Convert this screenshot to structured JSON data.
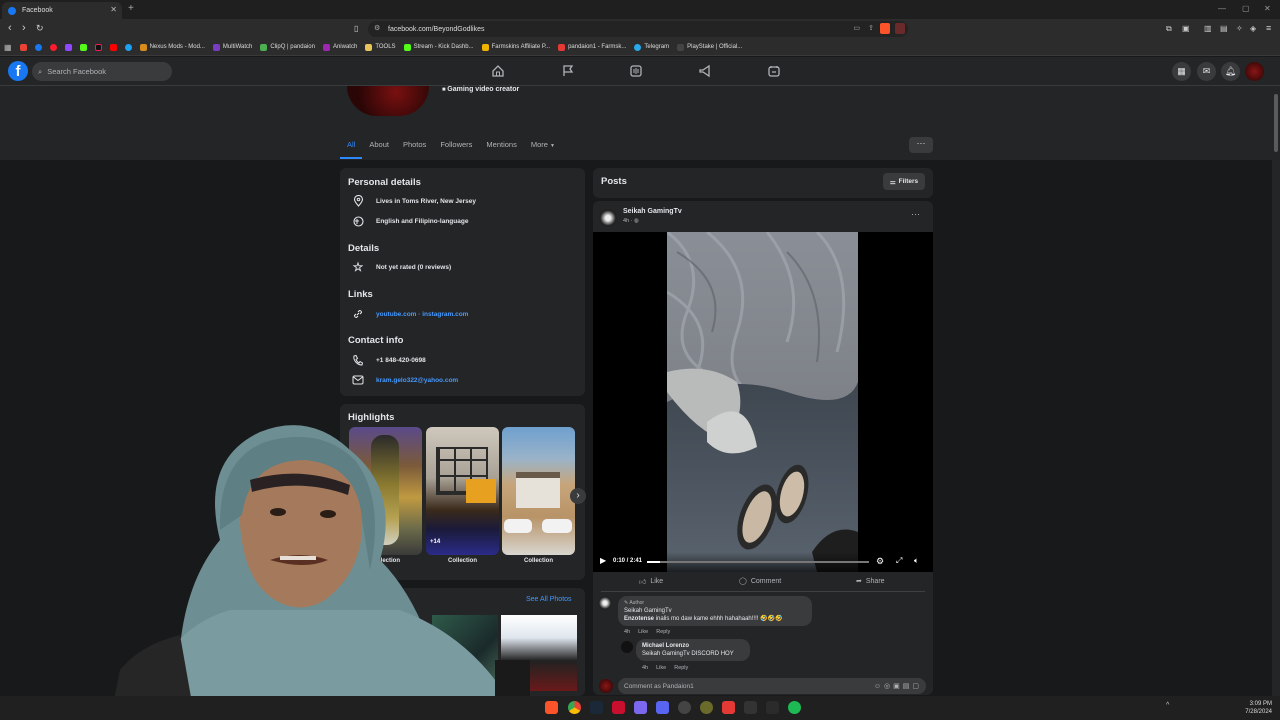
{
  "browser": {
    "tab_title": "Facebook",
    "url": "facebook.com/BeyondGodlikes",
    "new_tab": "+",
    "bookmarks": [
      {
        "label": "Nexus Mods - Mod...",
        "color": "#d98b1c"
      },
      {
        "label": "MultiWatch",
        "color": "#7a3cc2"
      },
      {
        "label": "ClipQ | pandaion",
        "color": "#4caf50"
      },
      {
        "label": "Aniwatch",
        "color": "#9c27b0"
      },
      {
        "label": "TOOLS",
        "color": "#e8c35a"
      },
      {
        "label": "Stream - Kick Dashb...",
        "color": "#53fc18"
      },
      {
        "label": "Farmskins Affiliate P...",
        "color": "#f0b400"
      },
      {
        "label": "pandaion1 - Farmsk...",
        "color": "#e53935"
      },
      {
        "label": "Telegram",
        "color": "#29a9eb"
      },
      {
        "label": "PlayStake | Official...",
        "color": "#444444"
      }
    ]
  },
  "fb": {
    "search_placeholder": "Search Facebook",
    "creator_label": "Gaming video creator",
    "tabs": [
      "All",
      "About",
      "Photos",
      "Followers",
      "Mentions",
      "More"
    ],
    "more_menu": "···"
  },
  "personal": {
    "heading": "Personal details",
    "lives": "Lives in Toms River, New Jersey",
    "language": "English and Filipino-language"
  },
  "details": {
    "heading": "Details",
    "rating": "Not yet rated (0 reviews)"
  },
  "links": {
    "heading": "Links",
    "text": "youtube.com · instagram.com"
  },
  "contact": {
    "heading": "Contact info",
    "phone": "+1 848-420-0698",
    "email": "kram.gelo322@yahoo.com"
  },
  "highlights": {
    "heading": "Highlights",
    "items": [
      {
        "caption": "Collection",
        "badge": ""
      },
      {
        "caption": "Collection",
        "badge": "+14"
      },
      {
        "caption": "Collection",
        "badge": ""
      }
    ],
    "see_all": "See All Photos"
  },
  "posts": {
    "heading": "Posts",
    "filters": "Filters",
    "author": "Seikah GamingTv",
    "time": "4h",
    "video_time": "0:10 / 2:41",
    "video_progress": 0.06,
    "actions": {
      "like": "Like",
      "comment": "Comment",
      "share": "Share"
    },
    "comments": [
      {
        "tag": "Author",
        "name": "Seikah GamingTv",
        "mention": "Enzotense",
        "text": "inalis mo daw kame ehhh hahahaah!!!! 🤣🤣🤣",
        "time": "4h",
        "like": "Like",
        "reply": "Reply"
      },
      {
        "tag": "",
        "name": "Michael Lorenzo",
        "mention": "Seikah GamingTv",
        "text": "DISCORD HOY",
        "time": "4h",
        "like": "Like",
        "reply": "Reply"
      }
    ],
    "comment_placeholder": "Comment as Pandaion1"
  },
  "clock": {
    "time": "3:09 PM",
    "date": "7/28/2024"
  }
}
